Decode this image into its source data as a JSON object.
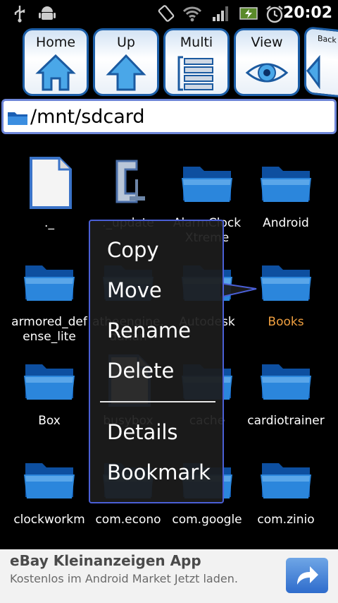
{
  "status_bar": {
    "time": "20:02"
  },
  "toolbar": {
    "buttons": [
      {
        "label": "Home"
      },
      {
        "label": "Up"
      },
      {
        "label": "Multi"
      },
      {
        "label": "View"
      },
      {
        "label": "Back"
      }
    ]
  },
  "path": "/mnt/sdcard",
  "files": [
    {
      "name": "._",
      "icon": "file"
    },
    {
      "name": "._update",
      "icon": "clamp"
    },
    {
      "name": "AlarmClock Xtreme",
      "icon": "folder"
    },
    {
      "name": "Android",
      "icon": "folder"
    },
    {
      "name": "armored_defense_lite",
      "icon": "folder"
    },
    {
      "name": "atheengine.dunan",
      "icon": "folder"
    },
    {
      "name": "Autodesk",
      "icon": "folder"
    },
    {
      "name": "Books",
      "icon": "folder",
      "highlight": true
    },
    {
      "name": "Box",
      "icon": "folder"
    },
    {
      "name": "busybox",
      "icon": "file"
    },
    {
      "name": "cache",
      "icon": "folder"
    },
    {
      "name": "cardiotrainer",
      "icon": "folder"
    },
    {
      "name": "clockworkm",
      "icon": "folder"
    },
    {
      "name": "com.econo",
      "icon": "folder"
    },
    {
      "name": "com.google",
      "icon": "folder"
    },
    {
      "name": "com.zinio",
      "icon": "folder"
    }
  ],
  "context_menu": {
    "items": [
      "Copy",
      "Move",
      "Rename",
      "Delete",
      "Details",
      "Bookmark"
    ]
  },
  "ad": {
    "title": "eBay Kleinanzeigen App",
    "subtitle": "Kostenlos im Android Market Jetzt laden."
  }
}
